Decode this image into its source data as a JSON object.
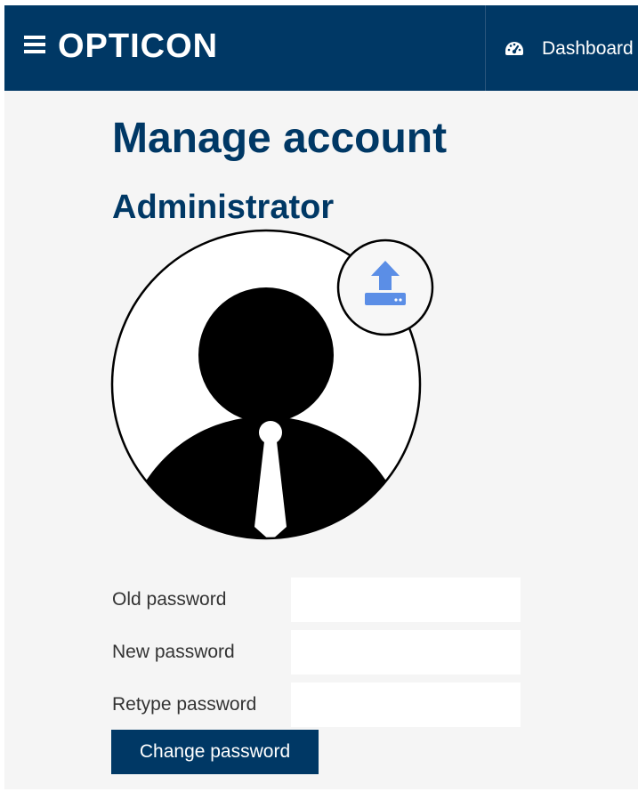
{
  "header": {
    "brand": "OPTICON",
    "menu_icon": "hamburger-menu-icon",
    "nav": {
      "dashboard_icon": "gauge-icon",
      "dashboard_label": "Dashboard"
    },
    "background_color": "#003865"
  },
  "main": {
    "title": "Manage account",
    "username": "Administrator",
    "avatar_icon": "user-silhouette-avatar",
    "upload_icon": "upload-icon",
    "accent_color": "#5b8ee6"
  },
  "password_form": {
    "old_password_label": "Old password",
    "new_password_label": "New password",
    "retype_password_label": "Retype password",
    "old_password_value": "",
    "new_password_value": "",
    "retype_password_value": "",
    "submit_label": "Change password"
  }
}
